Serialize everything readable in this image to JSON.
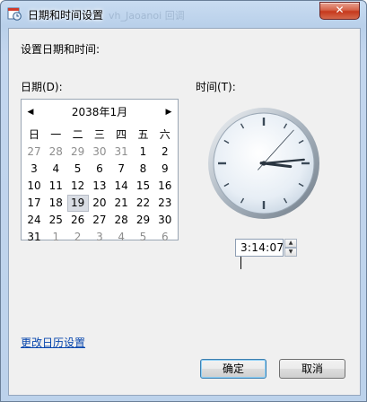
{
  "window": {
    "title": "日期和时间设置",
    "title_ghost": "vh_Jaoanoi 回调",
    "close_label": "✕"
  },
  "content": {
    "heading": "设置日期和时间:",
    "date_label": "日期(D):",
    "time_label": "时间(T):"
  },
  "calendar": {
    "month_label": "2038年1月",
    "prev_icon": "◀",
    "next_icon": "▶",
    "weekdays": [
      "日",
      "一",
      "二",
      "三",
      "四",
      "五",
      "六"
    ],
    "weeks": [
      [
        "27",
        "28",
        "29",
        "30",
        "31",
        "1",
        "2"
      ],
      [
        "3",
        "4",
        "5",
        "6",
        "7",
        "8",
        "9"
      ],
      [
        "10",
        "11",
        "12",
        "13",
        "14",
        "15",
        "16"
      ],
      [
        "17",
        "18",
        "19",
        "20",
        "21",
        "22",
        "23"
      ],
      [
        "24",
        "25",
        "26",
        "27",
        "28",
        "29",
        "30"
      ],
      [
        "31",
        "1",
        "2",
        "3",
        "4",
        "5",
        "6"
      ]
    ],
    "selected_day": "19"
  },
  "clock": {
    "hour": 3,
    "minute": 14,
    "second": 7
  },
  "time_input": {
    "value": "3:14:07",
    "up_icon": "▲",
    "down_icon": "▼"
  },
  "links": {
    "change_calendar": "更改日历设置"
  },
  "buttons": {
    "ok": "确定",
    "cancel": "取消"
  }
}
